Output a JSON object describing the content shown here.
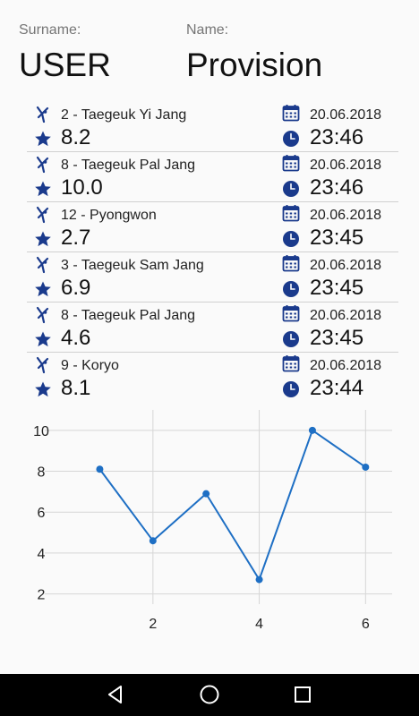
{
  "header": {
    "surname_label": "Surname:",
    "surname_value": "USER",
    "name_label": "Name:",
    "name_value": "Provision"
  },
  "entries": [
    {
      "form": "2 - Taegeuk Yi Jang",
      "score": "8.2",
      "date": "20.06.2018",
      "time": "23:46"
    },
    {
      "form": "8 - Taegeuk Pal Jang",
      "score": "10.0",
      "date": "20.06.2018",
      "time": "23:46"
    },
    {
      "form": "12 - Pyongwon",
      "score": "2.7",
      "date": "20.06.2018",
      "time": "23:45"
    },
    {
      "form": "3 - Taegeuk Sam Jang",
      "score": "6.9",
      "date": "20.06.2018",
      "time": "23:45"
    },
    {
      "form": "8 - Taegeuk Pal Jang",
      "score": "4.6",
      "date": "20.06.2018",
      "time": "23:45"
    },
    {
      "form": "9 - Koryo",
      "score": "8.1",
      "date": "20.06.2018",
      "time": "23:44"
    }
  ],
  "icons": {
    "kata": "taekwondo-kick-icon",
    "score": "star-icon",
    "date": "calendar-icon",
    "time": "clock-icon"
  },
  "colors": {
    "accent": "#1a3a8c",
    "line": "#1e6fc4",
    "grid": "#d6d6d6",
    "navbar": "#000000"
  },
  "chart_data": {
    "type": "line",
    "x": [
      1,
      2,
      3,
      4,
      5,
      6
    ],
    "y": [
      8.1,
      4.6,
      6.9,
      2.7,
      10.0,
      8.2
    ],
    "xticks": [
      2,
      4,
      6
    ],
    "yticks": [
      2,
      4,
      6,
      8,
      10
    ],
    "xlim": [
      0.1,
      6.5
    ],
    "ylim": [
      1.5,
      11.0
    ],
    "grid": true
  },
  "navbar": {
    "buttons": [
      "back-icon",
      "home-icon",
      "recents-icon"
    ]
  }
}
